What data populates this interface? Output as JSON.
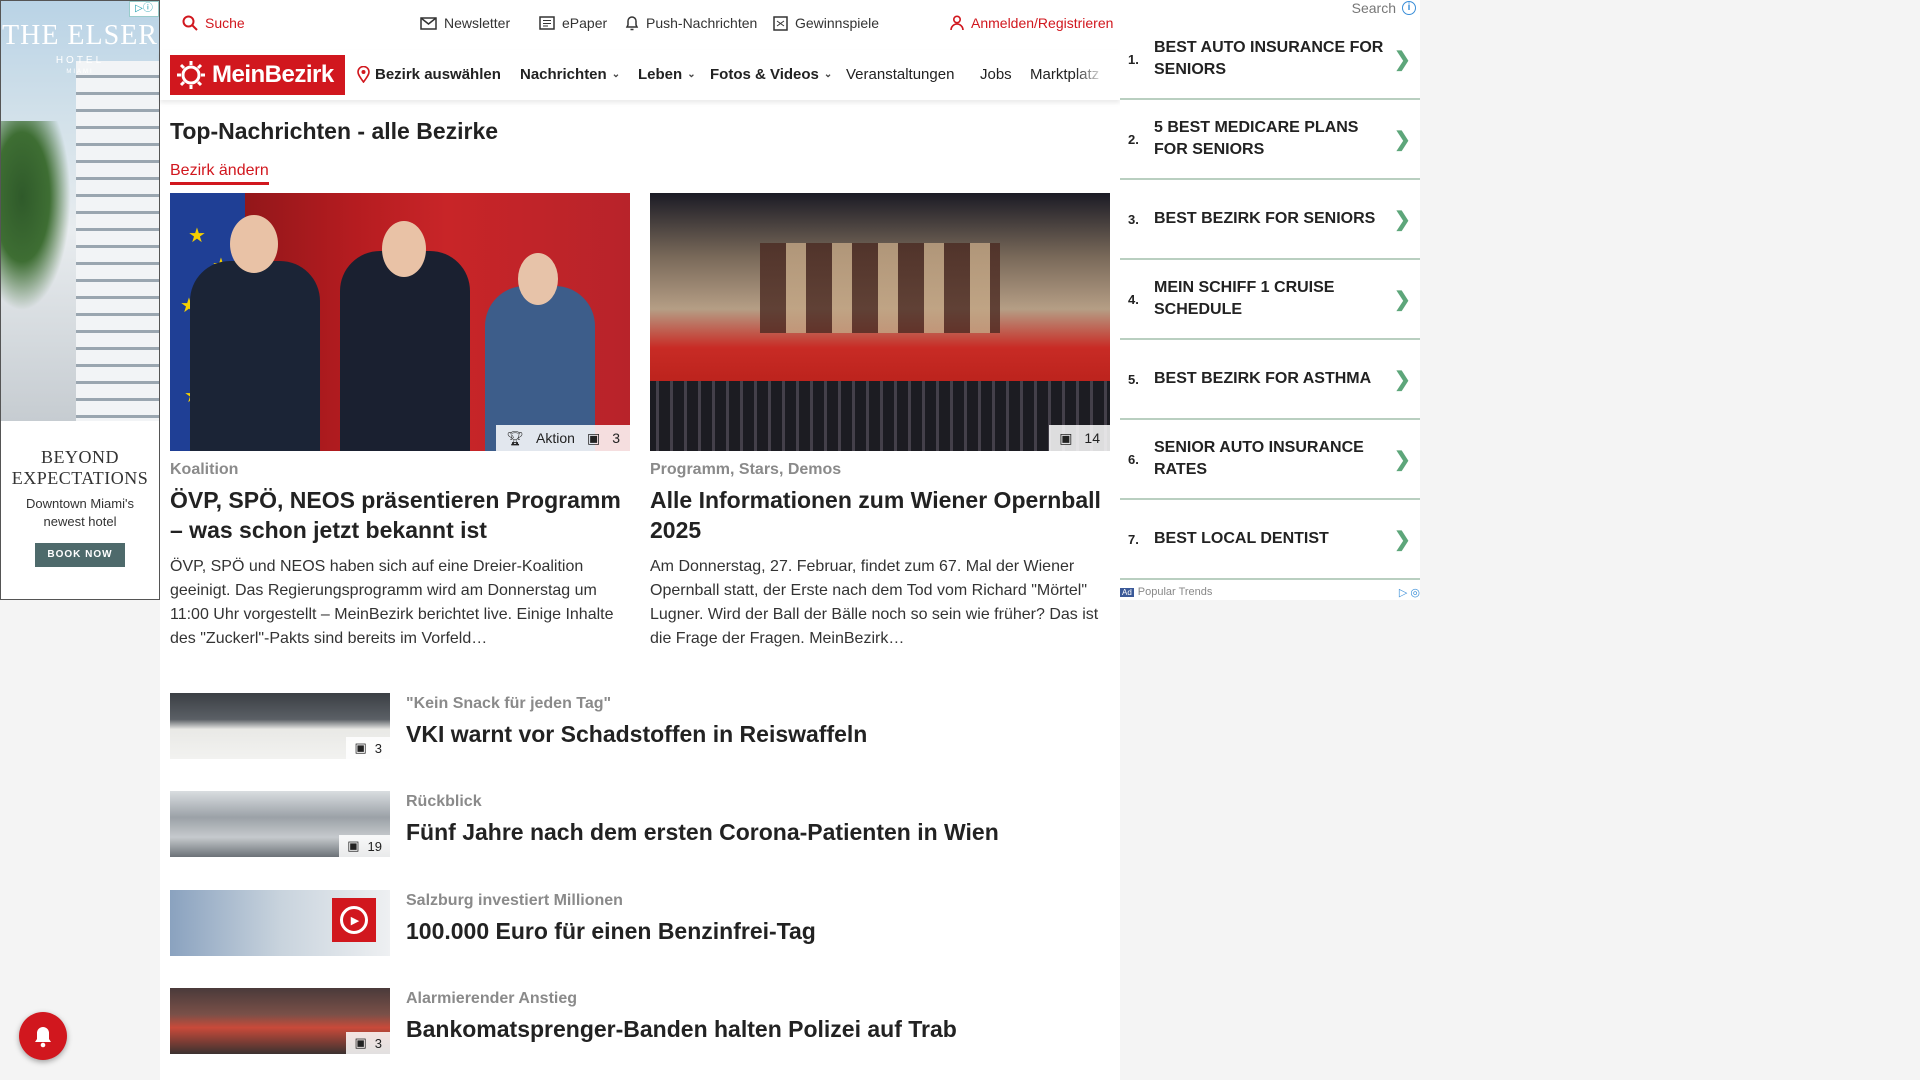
{
  "left_ad": {
    "brand": "THE ELSER",
    "brand_sub": "HOTEL",
    "brand_loc": "MIAMI",
    "headline_line1": "BEYOND",
    "headline_line2": "EXPECTATIONS",
    "tagline_line1": "Downtown Miami's",
    "tagline_line2": "newest hotel",
    "cta": "BOOK NOW"
  },
  "topbar": {
    "search": "Suche",
    "newsletter": "Newsletter",
    "epaper": "ePaper",
    "push": "Push-Nachrichten",
    "contests": "Gewinnspiele",
    "login": "Anmelden/Registrieren"
  },
  "nav": {
    "logo": "MeinBezirk",
    "district": "Bezirk auswählen",
    "items": [
      "Nachrichten",
      "Leben",
      "Fotos & Videos",
      "Veranstaltungen",
      "Jobs",
      "Marktplatz"
    ]
  },
  "page": {
    "title": "Top-Nachrichten - alle Bezirke",
    "change_district": "Bezirk ändern"
  },
  "featured": [
    {
      "kicker": "Koalition",
      "title": "ÖVP, SPÖ, NEOS präsentieren Programm – was schon jetzt bekannt ist",
      "teaser": "ÖVP, SPÖ und NEOS haben sich auf eine Dreier-Koalition geeinigt. Das Regierungsprogramm wird am Donnerstag um 11:00 Uhr vorgestellt – MeinBezirk berichtet live. Einige Inhalte des \"Zuckerl\"-Pakts sind bereits im Vorfeld…",
      "badge_label": "Aktion",
      "photo_count": "3"
    },
    {
      "kicker": "Programm, Stars, Demos",
      "title": "Alle Informationen zum Wiener Opernball 2025",
      "teaser": "Am Donnerstag, 27. Februar, findet zum 67. Mal der Wiener Opernball statt, der Erste nach dem Tod vom Richard \"Mörtel\" Lugner. Wird der Ball der Bälle noch so sein wie früher? Das ist die Frage der Fragen. MeinBezirk…",
      "photo_count": "14"
    }
  ],
  "articles": [
    {
      "kicker": "\"Kein Snack für jeden Tag\"",
      "title": "VKI warnt vor Schadstoffen in Reiswaffeln",
      "photo_count": "3"
    },
    {
      "kicker": "Rückblick",
      "title": "Fünf Jahre nach dem ersten Corona-Patienten in Wien",
      "photo_count": "19"
    },
    {
      "kicker": "Salzburg investiert Millionen",
      "title": "100.000 Euro für einen Benzinfrei-Tag"
    },
    {
      "kicker": "Alarmierender Anstieg",
      "title": "Bankomatsprenger-Banden halten Polizei auf Trab",
      "photo_count": "3"
    }
  ],
  "right_ad": {
    "search": "Search",
    "items": [
      {
        "num": "1.",
        "text": "Best Auto Insurance For Seniors"
      },
      {
        "num": "2.",
        "text": "5 Best Medicare Plans For Seniors"
      },
      {
        "num": "3.",
        "text": "Best Bezirk For Seniors"
      },
      {
        "num": "4.",
        "text": "Mein Schiff 1 Cruise Schedule"
      },
      {
        "num": "5.",
        "text": "Best Bezirk For Asthma"
      },
      {
        "num": "6.",
        "text": "Senior Auto Insurance Rates"
      },
      {
        "num": "7.",
        "text": "Best Local Dentist"
      }
    ],
    "ad_label": "Ad",
    "footer": "Popular Trends"
  },
  "colors": {
    "brand_red": "#d1171e",
    "ad_arrow": "#5da67a",
    "kicker_gray": "#8a8a8a"
  }
}
